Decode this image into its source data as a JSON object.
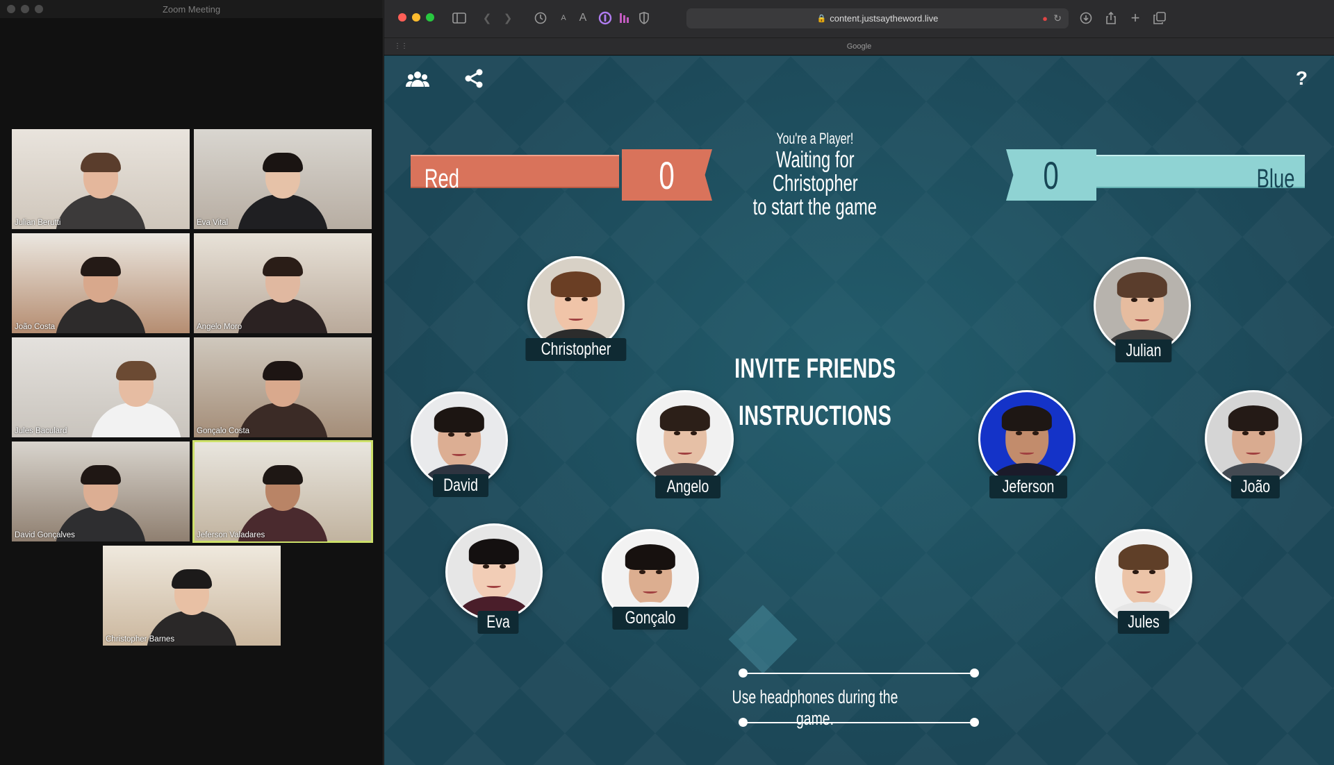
{
  "zoom": {
    "title": "Zoom Meeting",
    "participants": [
      {
        "name": "Julian Berutti"
      },
      {
        "name": "Eva Vital"
      },
      {
        "name": "João Costa"
      },
      {
        "name": "Angelo Moro"
      },
      {
        "name": "Jules Baculard"
      },
      {
        "name": "Gonçalo Costa"
      },
      {
        "name": "David Gonçalves"
      },
      {
        "name": "Jeferson Valadares"
      },
      {
        "name": "Christopher Barnes"
      }
    ]
  },
  "browser": {
    "url": "content.justsaytheword.live",
    "tab_title": "Google",
    "toolbar_text_small": "A",
    "toolbar_text_large": "A"
  },
  "game": {
    "help_label": "?",
    "teams": {
      "red": {
        "name": "Red",
        "score": "0",
        "color": "#d9735b"
      },
      "blue": {
        "name": "Blue",
        "score": "0",
        "color": "#8fd3d3"
      }
    },
    "status": {
      "line1": "You're a Player!",
      "line2": "Waiting for",
      "line3": "Christopher",
      "line4": "to start the game"
    },
    "menu": {
      "invite": "INVITE FRIENDS",
      "instructions": "INSTRUCTIONS"
    },
    "players": {
      "red": [
        "Christopher",
        "David",
        "Angelo",
        "Eva",
        "Gonçalo"
      ],
      "blue": [
        "Julian",
        "Jeferson",
        "João",
        "Jules"
      ]
    },
    "tip": "Use headphones during the game."
  }
}
